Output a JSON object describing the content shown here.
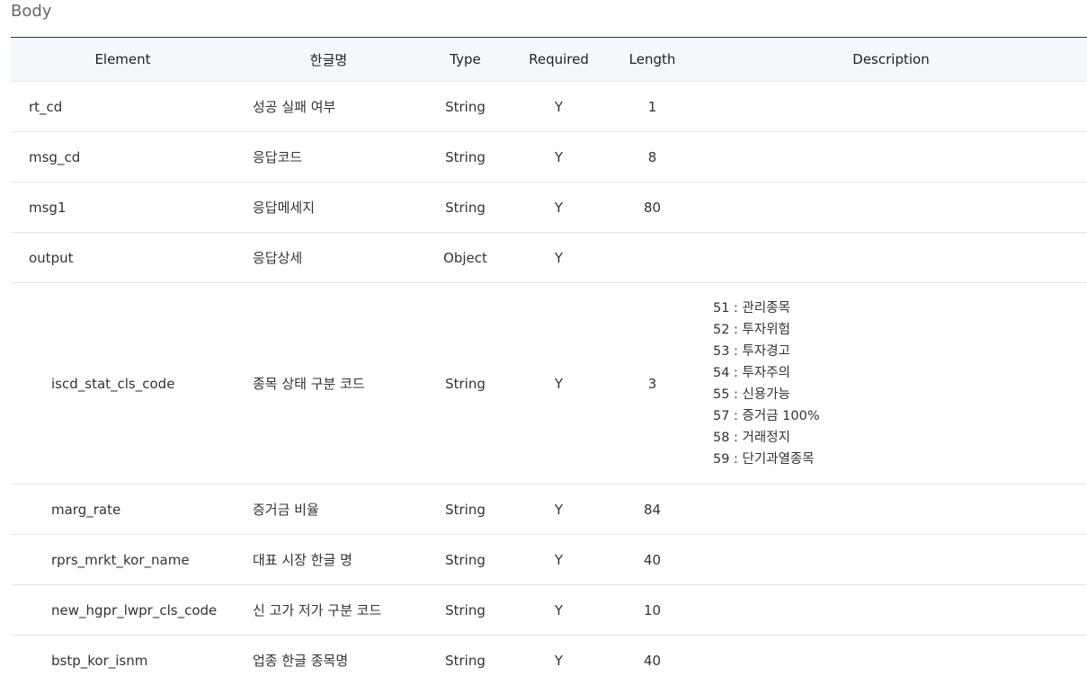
{
  "section": {
    "title": "Body"
  },
  "table": {
    "headers": {
      "element": "Element",
      "korean": "한글명",
      "type": "Type",
      "required": "Required",
      "length": "Length",
      "description": "Description"
    },
    "rows": [
      {
        "element": "rt_cd",
        "korean": "성공 실패 여부",
        "type": "String",
        "required": "Y",
        "length": "1"
      },
      {
        "element": "msg_cd",
        "korean": "응답코드",
        "type": "String",
        "required": "Y",
        "length": "8"
      },
      {
        "element": "msg1",
        "korean": "응답메세지",
        "type": "String",
        "required": "Y",
        "length": "80"
      },
      {
        "element": "output",
        "korean": "응답상세",
        "type": "Object",
        "required": "Y",
        "length": ""
      },
      {
        "element": "iscd_stat_cls_code",
        "korean": "종목 상태 구분 코드",
        "type": "String",
        "required": "Y",
        "length": "3",
        "description": [
          "51 : 관리종목",
          "52 : 투자위험",
          "53 : 투자경고",
          "54 : 투자주의",
          "55 : 신용가능",
          "57 : 증거금 100%",
          "58 : 거래정지",
          "59 : 단기과열종목"
        ]
      },
      {
        "element": "marg_rate",
        "korean": "증거금 비율",
        "type": "String",
        "required": "Y",
        "length": "84"
      },
      {
        "element": "rprs_mrkt_kor_name",
        "korean": "대표 시장 한글 명",
        "type": "String",
        "required": "Y",
        "length": "40"
      },
      {
        "element": "new_hgpr_lwpr_cls_code",
        "korean": "신 고가 저가 구분 코드",
        "type": "String",
        "required": "Y",
        "length": "10"
      },
      {
        "element": "bstp_kor_isnm",
        "korean": "업종 한글 종목명",
        "type": "String",
        "required": "Y",
        "length": "40"
      }
    ]
  }
}
